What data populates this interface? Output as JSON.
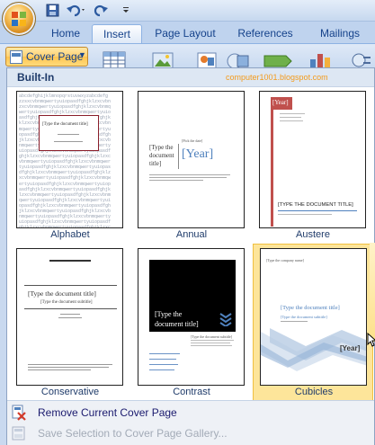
{
  "ribbon": {
    "tabs": [
      "Home",
      "Insert",
      "Page Layout",
      "References",
      "Mailings"
    ],
    "active_tab": "Insert",
    "cover_page_label": "Cover Page"
  },
  "gallery": {
    "header": "Built-In",
    "watermark": "computer1001.blogspot.com",
    "items": [
      {
        "name": "Alphabet"
      },
      {
        "name": "Annual"
      },
      {
        "name": "Austere"
      },
      {
        "name": "Conservative"
      },
      {
        "name": "Contrast"
      },
      {
        "name": "Cubicles"
      }
    ],
    "selected": "Cubicles",
    "thumb_text": {
      "type_title": "[Type the document title]",
      "type_title_caps": "[TYPE THE DOCUMENT TITLE]",
      "type_subtitle": "[Type the document subtitle]",
      "year": "[Year]",
      "pick_date": "[Pick the date]",
      "type_company": "[Type the company name]",
      "type_author": "[Type the author name]",
      "annual_title_1": "[Type the",
      "annual_title_2": "document",
      "annual_title_3": "title]",
      "contrast_title_1": "[Type the",
      "contrast_title_2": "document title]"
    },
    "menu": [
      {
        "label": "Remove Current Cover Page",
        "enabled": true
      },
      {
        "label": "Save Selection to Cover Page Gallery...",
        "enabled": false
      }
    ]
  },
  "colors": {
    "accent_blue": "#4f81bd",
    "austere_red": "#c0504d",
    "selection_yellow": "#fde59a",
    "watermark_orange": "#f39b1c"
  }
}
